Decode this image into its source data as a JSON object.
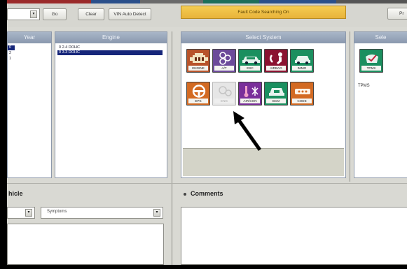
{
  "colors": {
    "panel_header": "#8a98ae",
    "selection": "#16267a",
    "fault_bar": "#e8b33a",
    "engine": "#b8532a",
    "at": "#6c4a9a",
    "esc": "#1b8f5f",
    "airbag": "#8a1230",
    "immo": "#1b8f5f",
    "eps": "#d36a22",
    "aircon": "#7a2f9a",
    "bcm": "#1b8f5f",
    "code": "#d36a22",
    "tpms": "#1b8f5f"
  },
  "toolbar": {
    "go_label": "Go",
    "clear_label": "Clear",
    "vin_label": "VIN Auto Detect",
    "fault_label": "Fault Code Searching On",
    "right_btn_label": "Pr"
  },
  "year_panel": {
    "header": "Year",
    "items": [
      "0",
      "2",
      "1"
    ]
  },
  "engine_panel": {
    "header": "Engine",
    "items": [
      {
        "label": "0 2.4 DOHC",
        "selected": false
      },
      {
        "label": "0 3.3 DOHC",
        "selected": true
      }
    ]
  },
  "system_panel": {
    "header": "Select System",
    "buttons": [
      {
        "label": "ENGINE",
        "icon": "engine-icon"
      },
      {
        "label": "A/T",
        "icon": "transmission-icon"
      },
      {
        "label": "ESC",
        "icon": "car-stability-icon"
      },
      {
        "label": "AIRBAG",
        "icon": "airbag-icon"
      },
      {
        "label": "IMMO",
        "icon": "immobilizer-key-icon"
      },
      {
        "label": "EPS",
        "icon": "steering-wheel-icon"
      },
      {
        "label": "ENG",
        "icon": "gear-icon",
        "disabled": true
      },
      {
        "label": "AIR/CON",
        "icon": "thermometer-snowflake-icon"
      },
      {
        "label": "BCM",
        "icon": "body-control-icon"
      },
      {
        "label": "CODE",
        "icon": "key-code-icon"
      }
    ]
  },
  "right_panel": {
    "header": "Sele",
    "buttons": [
      {
        "label": "TPMS",
        "icon": "tire-pressure-icon"
      }
    ],
    "caption": "TPMS"
  },
  "vehicle_section": {
    "title": "hicle",
    "symptoms_label": "Symptoms"
  },
  "comments_section": {
    "title": "Comments"
  }
}
